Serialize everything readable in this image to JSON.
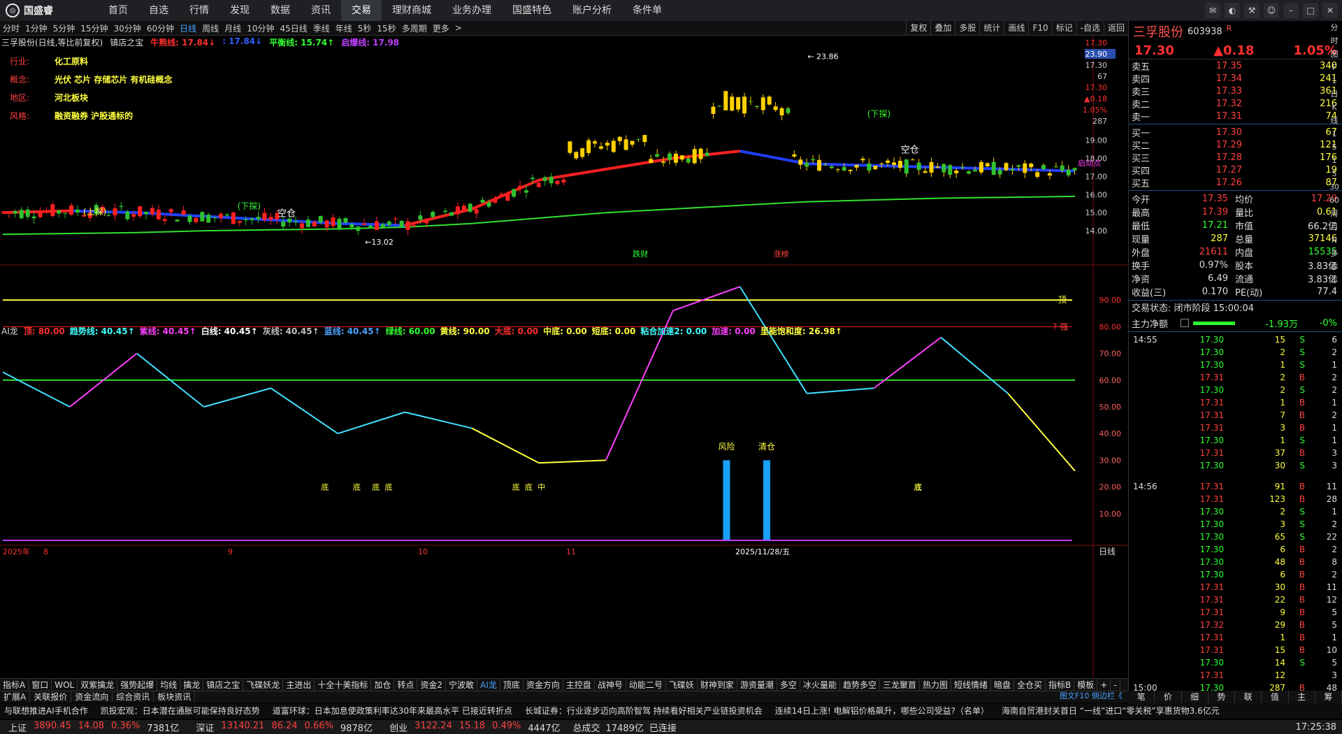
{
  "app": {
    "brand": "国盛睿"
  },
  "nav": [
    "首页",
    "自选",
    "行情",
    "发现",
    "数据",
    "资讯",
    "交易",
    "理财商城",
    "业务办理",
    "国盛特色",
    "账户分析",
    "条件单"
  ],
  "nav_active": 6,
  "periods": [
    "分时",
    "1分钟",
    "5分钟",
    "15分钟",
    "30分钟",
    "60分钟",
    "日线",
    "周线",
    "月线",
    "10分钟",
    "45日线",
    "季线",
    "年线",
    "5秒",
    "15秒",
    "多周期",
    "更多"
  ],
  "period_active": 6,
  "tools": [
    "复权",
    "叠加",
    "多股",
    "统计",
    "画线",
    "F10",
    "标记",
    "-自选",
    "返回"
  ],
  "kline_header": {
    "title": "三孚股份(日线,等比前复权)",
    "indicator": "镇店之宝",
    "items": [
      {
        "text": "牛熊线: 17.84↓",
        "color": "#ff3030"
      },
      {
        "text": ": 17.84↓",
        "color": "#3060ff"
      },
      {
        "text": "平衡线: 15.74↑",
        "color": "#30ff30"
      },
      {
        "text": "启爆线: 17.98",
        "color": "#c040ff"
      }
    ]
  },
  "info": [
    {
      "k": "行业:",
      "v": "化工原料"
    },
    {
      "k": "概念:",
      "v": "光伏 芯片 存储芯片 有机硅概念"
    },
    {
      "k": "地区:",
      "v": "河北板块"
    },
    {
      "k": "风格:",
      "v": "融资融券 沪股通标的"
    }
  ],
  "price_axis": [
    "17.30",
    "23.90",
    "17.30",
    "67",
    "17.30",
    "▲0.18",
    "1.05%",
    "287",
    "19.00",
    "18.00",
    "17.00",
    "16.00",
    "15.00",
    "14.00"
  ],
  "chart_labels": {
    "high": "23.86",
    "low": "13.02",
    "kongcang": "空仓",
    "xiatan": "(下探)",
    "shangtan": "(上探)",
    "qidongdian": "启动点",
    "diecai": "跌财",
    "zhangbang": "涨榜"
  },
  "ai_header": {
    "name": "AI龙",
    "items": [
      {
        "text": "顶: 80.00",
        "color": "#ff3030"
      },
      {
        "text": "趋势线: 40.45↑",
        "color": "#40ffff"
      },
      {
        "text": "紫线: 40.45↑",
        "color": "#ff40ff"
      },
      {
        "text": "白线: 40.45↑",
        "color": "#ffffff"
      },
      {
        "text": "灰线: 40.45↑",
        "color": "#c0c0c0"
      },
      {
        "text": "蓝线: 40.45↑",
        "color": "#4aa3ff"
      },
      {
        "text": "绿线: 60.00",
        "color": "#30ff30"
      },
      {
        "text": "黄线: 90.00",
        "color": "#ffff40"
      },
      {
        "text": "大底: 0.00",
        "color": "#ff3030"
      },
      {
        "text": "中底: 0.00",
        "color": "#ffff40"
      },
      {
        "text": "短底: 0.00",
        "color": "#ffff40"
      },
      {
        "text": "粘合加速2: 0.00",
        "color": "#40ffff"
      },
      {
        "text": "加速: 0.00",
        "color": "#ff40ff"
      },
      {
        "text": "里能饱和度: 26.98↑",
        "color": "#ffff40"
      }
    ]
  },
  "ai_axis": [
    "90.00",
    "80.00",
    "70.00",
    "60.00",
    "50.00",
    "40.00",
    "30.00",
    "20.00",
    "10.00"
  ],
  "ai_labels": {
    "ding": "顶",
    "qiang": "? 强",
    "risk": "风险",
    "clear": "清仓",
    "di": "底",
    "duan": "短",
    "zhong": "中"
  },
  "date_axis": [
    "2025年",
    "8",
    "9",
    "10",
    "11",
    "2025/11/28/五"
  ],
  "date_axis_right": "日线",
  "stock": {
    "name": "三孚股份",
    "code": "603938",
    "tag": "R",
    "price": "17.30",
    "change": "▲0.18",
    "pct": "1.05%"
  },
  "orderbook": {
    "asks": [
      [
        "卖五",
        "17.35",
        "340"
      ],
      [
        "卖四",
        "17.34",
        "241"
      ],
      [
        "卖三",
        "17.33",
        "361"
      ],
      [
        "卖二",
        "17.32",
        "216"
      ],
      [
        "卖一",
        "17.31",
        "74"
      ]
    ],
    "bids": [
      [
        "买一",
        "17.30",
        "67"
      ],
      [
        "买二",
        "17.29",
        "121"
      ],
      [
        "买三",
        "17.28",
        "176"
      ],
      [
        "买四",
        "17.27",
        "19"
      ],
      [
        "买五",
        "17.26",
        "87"
      ]
    ]
  },
  "stats": [
    [
      "今开",
      "17.35",
      "均价",
      "17.29"
    ],
    [
      "最高",
      "17.39",
      "量比",
      "0.61"
    ],
    [
      "最低",
      "17.21",
      "市值",
      "66.2亿"
    ],
    [
      "现量",
      "287",
      "总量",
      "37146"
    ],
    [
      "外盘",
      "21611",
      "内盘",
      "15535"
    ],
    [
      "换手",
      "0.97%",
      "股本",
      "3.83亿"
    ],
    [
      "净资",
      "6.49",
      "流通",
      "3.83亿"
    ],
    [
      "收益(三)",
      "0.170",
      "PE(动)",
      "77.4"
    ]
  ],
  "trade_state": "交易状态: 闭市阶段 15:00:04",
  "flow": {
    "label": "主力净额",
    "value": "-1.93万",
    "pct": "-0%"
  },
  "trades_1455": [
    [
      "14:55",
      "17.30",
      "15",
      "S",
      "6"
    ],
    [
      "",
      "17.30",
      "2",
      "S",
      "2"
    ],
    [
      "",
      "17.30",
      "1",
      "S",
      "1"
    ],
    [
      "",
      "17.31",
      "2",
      "B",
      "2"
    ],
    [
      "",
      "17.30",
      "2",
      "S",
      "2"
    ],
    [
      "",
      "17.31",
      "1",
      "B",
      "1"
    ],
    [
      "",
      "17.31",
      "7",
      "B",
      "2"
    ],
    [
      "",
      "17.31",
      "3",
      "B",
      "1"
    ],
    [
      "",
      "17.30",
      "1",
      "S",
      "1"
    ],
    [
      "",
      "17.31",
      "37",
      "B",
      "3"
    ],
    [
      "",
      "17.30",
      "30",
      "S",
      "3"
    ]
  ],
  "trades_1456": [
    [
      "14:56",
      "17.31",
      "91",
      "B",
      "11"
    ],
    [
      "",
      "17.31",
      "123",
      "B",
      "28"
    ],
    [
      "",
      "17.30",
      "2",
      "S",
      "1"
    ],
    [
      "",
      "17.30",
      "3",
      "S",
      "2"
    ],
    [
      "",
      "17.30",
      "65",
      "S",
      "22"
    ],
    [
      "",
      "17.30",
      "6",
      "B",
      "2"
    ],
    [
      "",
      "17.30",
      "48",
      "B",
      "8"
    ],
    [
      "",
      "17.30",
      "6",
      "B",
      "2"
    ],
    [
      "",
      "17.31",
      "30",
      "B",
      "11"
    ],
    [
      "",
      "17.31",
      "22",
      "B",
      "12"
    ],
    [
      "",
      "17.31",
      "9",
      "B",
      "5"
    ],
    [
      "",
      "17.32",
      "29",
      "B",
      "5"
    ],
    [
      "",
      "17.31",
      "1",
      "B",
      "1"
    ],
    [
      "",
      "17.31",
      "15",
      "B",
      "10"
    ],
    [
      "",
      "17.30",
      "14",
      "S",
      "5"
    ],
    [
      "",
      "17.31",
      "12",
      "",
      "3"
    ],
    [
      "15:00",
      "17.30",
      "287",
      "B",
      "48"
    ]
  ],
  "vtabs": [
    "分",
    "时",
    "图",
    "F",
    "1",
    "日",
    "K",
    "线",
    "1",
    "5",
    "1",
    "5",
    "30",
    "60",
    "周",
    "月",
    "N",
    "多",
    "季",
    "年"
  ],
  "indicator_tabs": [
    "指标A",
    "窗口",
    "WOL",
    "双紫擒龙",
    "强势起爆",
    "均线",
    "擒龙",
    "镇店之宝",
    "飞碟妖龙",
    "主进出",
    "十全十美指标",
    "加仓",
    "转点",
    "资金2",
    "宁波敢",
    "AI龙",
    "顶底",
    "资金方向",
    "主控盘",
    "战神号",
    "动能二号",
    "飞碟妖",
    "财神到家",
    "游资量潮",
    "多空",
    "冰火量能",
    "趋势多空",
    "三龙聚首",
    "热力图",
    "短线情绪",
    "暗盘",
    "全仓买",
    "指标B",
    "模板",
    "+",
    "-"
  ],
  "indicator_active": 15,
  "second_tabs": [
    "扩展A",
    "关联报价",
    "资金流向",
    "综合资讯",
    "板块资讯"
  ],
  "rp_tabs": [
    "笔",
    "价",
    "细",
    "势",
    "联",
    "值",
    "主",
    "筹"
  ],
  "rp_info_label": "图文F10 侧边栏《",
  "news": [
    "与联想推进AI手机合作",
    "凯投宏观：日本潜在通胀可能保持良好态势",
    "道富环球：日本加息使政策利率达30年来最高水平 已接近转折点",
    "长城证券：行业逐步迈向高阶智驾 持续看好相关产业链投资机会",
    "连续14日上涨! 电解铝价格飙升，哪些公司受益?（名单）",
    "海南自贸港封关首日 “一线”进口“零关税”享惠货物3.6亿元"
  ],
  "indices": [
    {
      "name": "上证",
      "v": "3890.45",
      "c": "14.08",
      "p": "0.36%",
      "amt": "7381亿"
    },
    {
      "name": "深证",
      "v": "13140.21",
      "c": "86.24",
      "p": "0.66%",
      "amt": "9878亿"
    },
    {
      "name": "创业",
      "v": "3122.24",
      "c": "15.18",
      "p": "0.49%",
      "amt": "4447亿"
    }
  ],
  "total_label": "总成交",
  "total_amt": "17489亿",
  "conn": "已连接",
  "clock": "17:25:38",
  "colors": {
    "up": "#ff3030",
    "down": "#30ff30",
    "accent": "#4aa3ff"
  },
  "chart_data": [
    {
      "type": "line",
      "title": "三孚股份(日线,等比前复权)",
      "xlabel": "",
      "ylabel": "",
      "ylim": [
        13.0,
        24.0
      ],
      "note_series_values_estimated": true,
      "x": [
        0,
        10,
        20,
        30,
        40,
        50,
        60,
        70,
        80,
        90,
        100,
        110,
        120,
        130,
        140,
        150,
        160
      ],
      "series": [
        {
          "name": "牛熊线",
          "values": [
            15.0,
            15.1,
            15.0,
            14.8,
            14.6,
            14.4,
            14.3,
            15.2,
            16.8,
            17.4,
            18.0,
            18.4,
            17.7,
            17.6,
            17.5,
            17.4,
            17.3
          ]
        },
        {
          "name": "平衡线",
          "values": [
            13.8,
            13.85,
            13.9,
            14.0,
            14.05,
            14.1,
            14.2,
            14.4,
            14.7,
            15.0,
            15.2,
            15.4,
            15.6,
            15.7,
            15.8,
            15.85,
            15.9
          ]
        }
      ]
    },
    {
      "type": "line",
      "title": "AI龙",
      "xlabel": "",
      "ylabel": "",
      "ylim": [
        0,
        100
      ],
      "x": [
        0,
        10,
        20,
        30,
        40,
        50,
        60,
        70,
        80,
        90,
        100,
        110,
        120,
        130,
        140,
        150,
        160
      ],
      "series": [
        {
          "name": "趋势线",
          "values": [
            63,
            50,
            70,
            50,
            57,
            40,
            48,
            42,
            29,
            30,
            86,
            95,
            55,
            57,
            76,
            55,
            26
          ]
        },
        {
          "name": "绿线",
          "values": [
            60,
            60,
            60,
            60,
            60,
            60,
            60,
            60,
            60,
            60,
            60,
            60,
            60,
            60,
            60,
            60,
            60
          ]
        },
        {
          "name": "黄线",
          "values": [
            90,
            90,
            90,
            90,
            90,
            90,
            90,
            90,
            90,
            90,
            90,
            90,
            90,
            90,
            90,
            90,
            90
          ]
        },
        {
          "name": "顶",
          "values": [
            80,
            80,
            80,
            80,
            80,
            80,
            80,
            80,
            80,
            80,
            80,
            80,
            80,
            80,
            80,
            80,
            80
          ]
        }
      ]
    }
  ]
}
